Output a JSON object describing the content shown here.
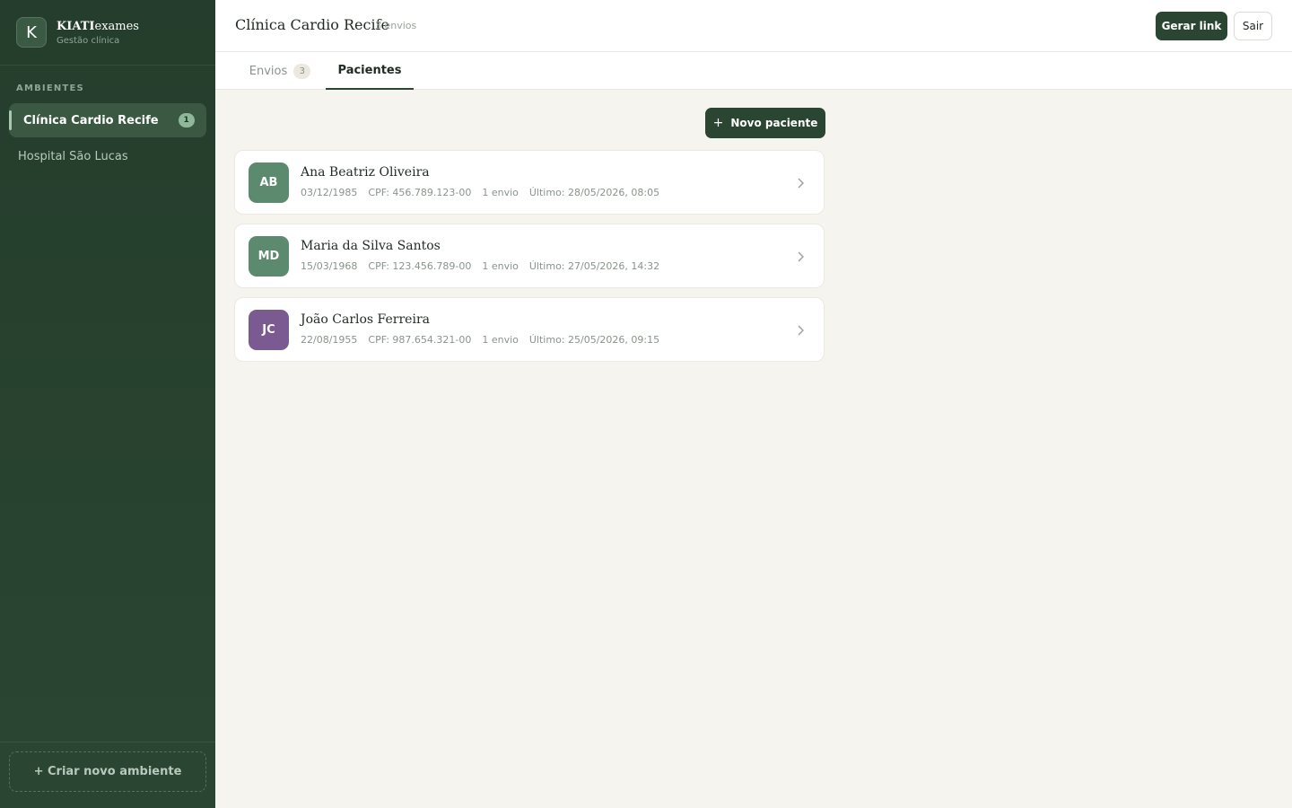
{
  "brand": {
    "logo_letter": "K",
    "name_bold": "KIATI",
    "name_rest": "exames",
    "subtitle": "Gestão clínica"
  },
  "sidebar": {
    "section_label": "AMBIENTES",
    "items": [
      {
        "label": "Clínica Cardio Recife",
        "badge": "1",
        "active": true
      },
      {
        "label": "Hospital São Lucas",
        "active": false
      }
    ],
    "create_label": "+ Criar novo ambiente"
  },
  "header": {
    "title": "Clínica Cardio Recife",
    "count_label": "3 envios",
    "generate_label": "Gerar link",
    "exit_label": "Sair"
  },
  "tabs": [
    {
      "label": "Envios",
      "count": "3",
      "active": false
    },
    {
      "label": "Pacientes",
      "active": true
    }
  ],
  "actions": {
    "new_patient_icon": "+",
    "new_patient_label": "Novo paciente"
  },
  "patients": [
    {
      "initials": "AB",
      "avatar_color": "#5b8a6e",
      "name": "Ana Beatriz Oliveira",
      "birth": "03/12/1985",
      "cpf": "CPF: 456.789.123-00",
      "sends": "1 envio",
      "last": "Último: 28/05/2026, 08:05"
    },
    {
      "initials": "MD",
      "avatar_color": "#5b8a6e",
      "name": "Maria da Silva Santos",
      "birth": "15/03/1968",
      "cpf": "CPF: 123.456.789-00",
      "sends": "1 envio",
      "last": "Último: 27/05/2026, 14:32"
    },
    {
      "initials": "JC",
      "avatar_color": "#7a5a90",
      "name": "João Carlos Ferreira",
      "birth": "22/08/1955",
      "cpf": "CPF: 987.654.321-00",
      "sends": "1 envio",
      "last": "Último: 25/05/2026, 09:15"
    }
  ],
  "colors": {
    "sidebar_bg": "#253d2c",
    "primary": "#2a4532",
    "page_bg": "#f6f4ef"
  }
}
